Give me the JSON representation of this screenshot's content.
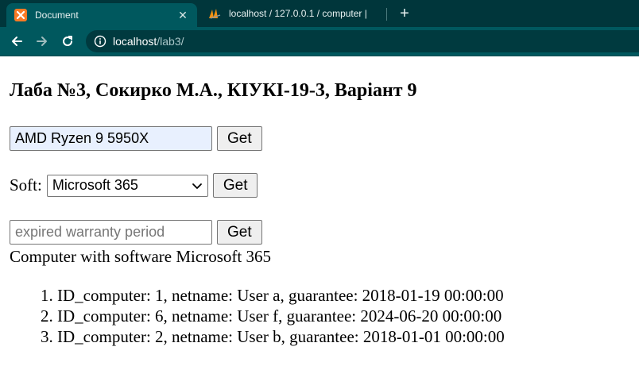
{
  "browser": {
    "tabs": [
      {
        "title": "Document",
        "active": true
      },
      {
        "title": "localhost / 127.0.0.1 / computer |",
        "active": false
      }
    ],
    "address": {
      "host": "localhost",
      "path": "/lab3/"
    }
  },
  "page": {
    "heading": "Лаба №3, Сокирко М.А., КІУКІ-19-3, Варіант 9",
    "cpu_form": {
      "value": "AMD Ryzen 9 5950X",
      "button": "Get"
    },
    "soft_form": {
      "label": "Soft:",
      "selected": "Microsoft 365",
      "button": "Get"
    },
    "warranty_form": {
      "placeholder": "expired warranty period",
      "button": "Get"
    },
    "result": {
      "title": "Computer with software Microsoft 365",
      "items": [
        "ID_computer: 1, netname: User a, guarantee: 2018-01-19 00:00:00",
        "ID_computer: 6, netname: User f, guarantee: 2024-06-20 00:00:00",
        "ID_computer: 2, netname: User b, guarantee: 2018-01-01 00:00:00"
      ]
    }
  },
  "colors": {
    "tabbar": "#00363b",
    "toolbar": "#00585e",
    "omnibox": "#003a3f"
  }
}
